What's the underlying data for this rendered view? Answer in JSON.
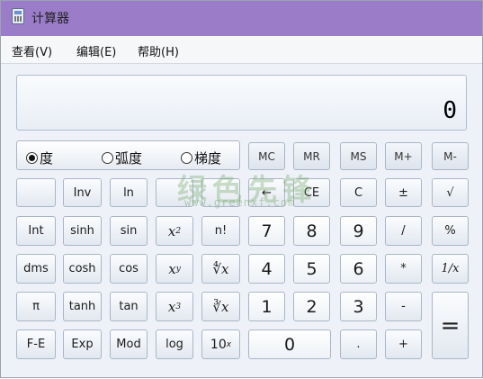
{
  "window": {
    "title": "计算器"
  },
  "menu": {
    "items": [
      "查看(V)",
      "编辑(E)",
      "帮助(H)"
    ]
  },
  "display": {
    "value": "0"
  },
  "angle_mode": {
    "options": [
      "度",
      "弧度",
      "梯度"
    ],
    "selected": "度"
  },
  "memory": [
    "MC",
    "MR",
    "MS",
    "M+",
    "M-"
  ],
  "buttons": {
    "inv": "Inv",
    "ln": "ln",
    "backspace": "←",
    "ce": "CE",
    "clear": "C",
    "plusminus": "±",
    "sqrt": "√",
    "int": "Int",
    "sinh": "sinh",
    "sin": "sin",
    "x2": "x",
    "x2_sup": "2",
    "factorial": "n!",
    "seven": "7",
    "eight": "8",
    "nine": "9",
    "divide": "/",
    "percent": "%",
    "dms": "dms",
    "cosh": "cosh",
    "cos": "cos",
    "xy": "x",
    "xy_sup": "y",
    "yroot": "∜x",
    "four": "4",
    "five": "5",
    "six": "6",
    "multiply": "*",
    "reciprocal": "1/x",
    "pi": "π",
    "tanh": "tanh",
    "tan": "tan",
    "x3": "x",
    "x3_sup": "3",
    "cuberoot": "∛x",
    "one": "1",
    "two": "2",
    "three": "3",
    "minus": "-",
    "equals": "=",
    "fe": "F-E",
    "exp": "Exp",
    "mod": "Mod",
    "log": "log",
    "tenx": "10",
    "tenx_sup": "x",
    "zero": "0",
    "decimal": ".",
    "plus": "+"
  },
  "watermark": {
    "text": "绿色先锋",
    "url": "www.greenxf.com"
  }
}
